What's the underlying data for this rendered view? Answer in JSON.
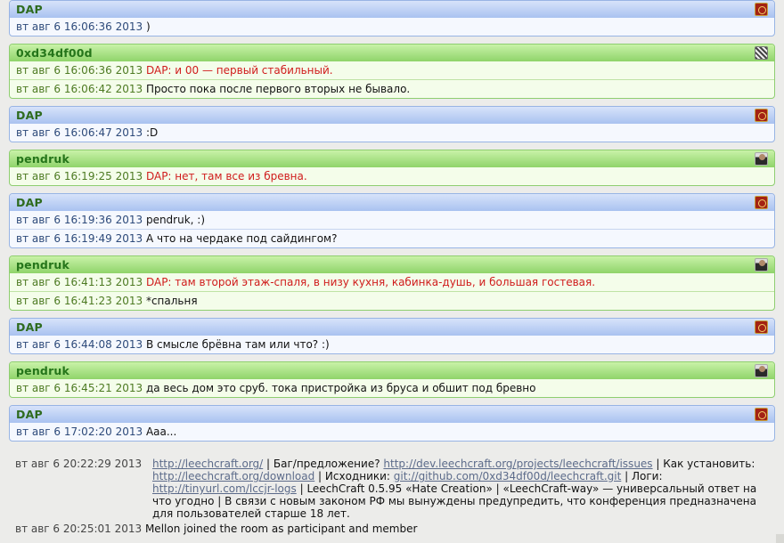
{
  "blocks": [
    {
      "nick": "DAP",
      "style": "dap",
      "avatar": "dap",
      "messages": [
        {
          "time": "вт авг 6 16:06:36 2013",
          "text": ")",
          "hl": false
        }
      ]
    },
    {
      "nick": "0xd34df00d",
      "style": "green",
      "avatar": "0xd",
      "messages": [
        {
          "time": "вт авг 6 16:06:36 2013",
          "text": "DAP: и 00 — первый стабильный.",
          "hl": true
        },
        {
          "time": "вт авг 6 16:06:42 2013",
          "text": "Просто пока после первого вторых не бывало.",
          "hl": false
        }
      ]
    },
    {
      "nick": "DAP",
      "style": "dap",
      "avatar": "dap",
      "messages": [
        {
          "time": "вт авг 6 16:06:47 2013",
          "text": ":D",
          "hl": false
        }
      ]
    },
    {
      "nick": "pendruk",
      "style": "green",
      "avatar": "pend",
      "messages": [
        {
          "time": "вт авг 6 16:19:25 2013",
          "text": "DAP: нет, там все из бревна.",
          "hl": true
        }
      ]
    },
    {
      "nick": "DAP",
      "style": "dap",
      "avatar": "dap",
      "messages": [
        {
          "time": "вт авг 6 16:19:36 2013",
          "text": "pendruk, :)",
          "hl": false
        },
        {
          "time": "вт авг 6 16:19:49 2013",
          "text": "А что на чердаке под сайдингом?",
          "hl": false
        }
      ]
    },
    {
      "nick": "pendruk",
      "style": "green",
      "avatar": "pend",
      "messages": [
        {
          "time": "вт авг 6 16:41:13 2013",
          "text": "DAP: там второй этаж-спаля, в низу кухня, кабинка-душь, и большая гостевая.",
          "hl": true
        },
        {
          "time": "вт авг 6 16:41:23 2013",
          "text": "*спальня",
          "hl": false
        }
      ]
    },
    {
      "nick": "DAP",
      "style": "dap",
      "avatar": "dap",
      "messages": [
        {
          "time": "вт авг 6 16:44:08 2013",
          "text": "В смысле брёвна там или что? :)",
          "hl": false
        }
      ]
    },
    {
      "nick": "pendruk",
      "style": "green",
      "avatar": "pend",
      "messages": [
        {
          "time": "вт авг 6 16:45:21 2013",
          "text": "да весь дом это сруб. тока пристройка из бруса и обшит под бревно",
          "hl": false
        }
      ]
    },
    {
      "nick": "DAP",
      "style": "dap",
      "avatar": "dap",
      "messages": [
        {
          "time": "вт авг 6 17:02:20 2013",
          "text": "Ааа...",
          "hl": false
        }
      ]
    }
  ],
  "topic": {
    "time": "вт авг 6 20:22:29 2013",
    "link1": "http://leechcraft.org/",
    "t1": " | Баг/предложение? ",
    "link2": "http://dev.leechcraft.org/projects/leechcraft/issues",
    "t2": " | Как установить: ",
    "link3": "http://leechcraft.org/download",
    "t3": " | Исходники: ",
    "link4": "git://github.com/0xd34df00d/leechcraft.git",
    "t4": " | Логи: ",
    "link5": "http://tinyurl.com/lccjr-logs",
    "t5": " | LeechCraft 0.5.95 «Hate Creation» | «LeechCraft-way» — универсальный ответ на что угодно | В связи с новым законом РФ мы вынуждены предупредить, что конференция предназначена для пользователей старше 18 лет."
  },
  "event": {
    "time": "вт авг 6 20:25:01 2013",
    "text": "Mellon joined the room as participant and member"
  }
}
